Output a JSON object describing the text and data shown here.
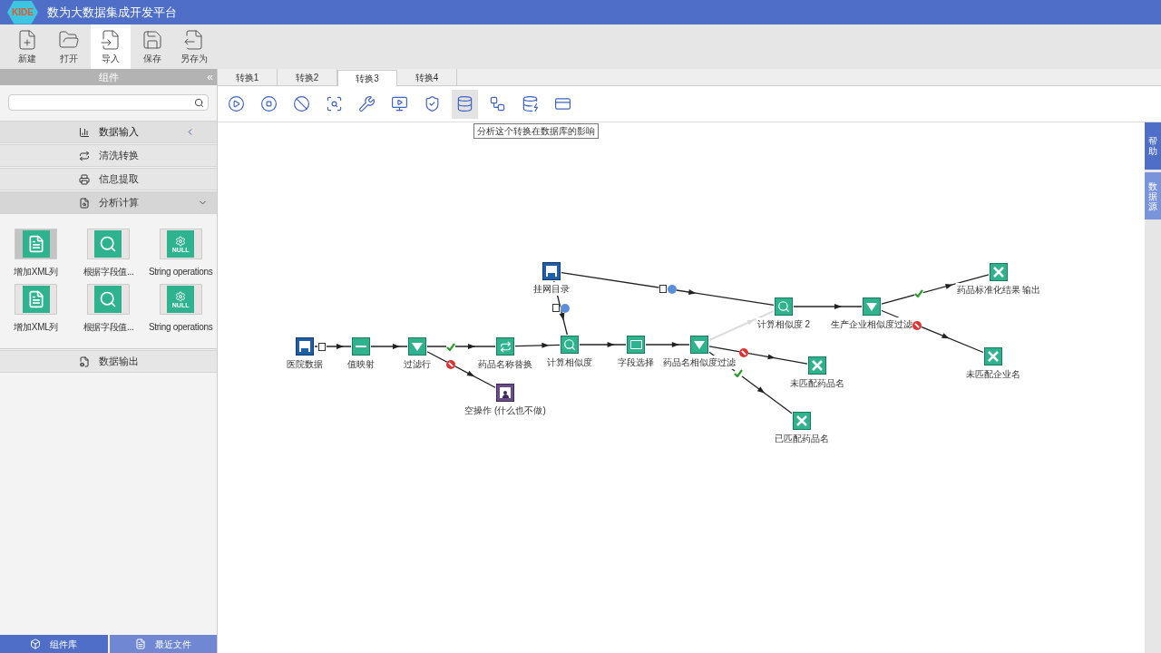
{
  "app": {
    "logo_text": "KIDE",
    "title": "数为大数据集成开发平台"
  },
  "toolbar": [
    {
      "label": "新建",
      "kind": "new",
      "selected": false
    },
    {
      "label": "打开",
      "kind": "open",
      "selected": false
    },
    {
      "label": "导入",
      "kind": "import",
      "selected": true
    },
    {
      "label": "保存",
      "kind": "save",
      "selected": false
    },
    {
      "label": "另存为",
      "kind": "saveas",
      "selected": false
    }
  ],
  "sidebar": {
    "title": "组件",
    "collapse_glyph": "«",
    "categories": [
      {
        "label": "数据输入",
        "kind": "input",
        "expanded": false,
        "hovered": true
      },
      {
        "label": "清洗转换",
        "kind": "clean",
        "expanded": false,
        "hovered": false
      },
      {
        "label": "信息提取",
        "kind": "extract",
        "expanded": false,
        "hovered": false
      },
      {
        "label": "分析计算",
        "kind": "analyze",
        "expanded": true,
        "hovered": false,
        "components": [
          {
            "label": "增加XML列",
            "kind": "xml",
            "selected": true
          },
          {
            "label": "根据字段值...",
            "kind": "lookup",
            "selected": false
          },
          {
            "label": "String operations",
            "kind": "string",
            "badge": "NULL",
            "selected": false
          },
          {
            "label": "增加XML列",
            "kind": "xml",
            "selected": false
          },
          {
            "label": "根据字段值...",
            "kind": "lookup",
            "selected": false
          },
          {
            "label": "String operations",
            "kind": "string",
            "badge": "NULL",
            "selected": false
          }
        ]
      },
      {
        "label": "数据输出",
        "kind": "output",
        "expanded": false,
        "hovered": false
      }
    ]
  },
  "bottom_tabs": [
    {
      "label": "组件库",
      "kind": "library",
      "selected": true
    },
    {
      "label": "最近文件",
      "kind": "recent",
      "selected": false
    }
  ],
  "tabs": [
    {
      "label": "转换1",
      "selected": false
    },
    {
      "label": "转换2",
      "selected": false
    },
    {
      "label": "转换3",
      "selected": true
    },
    {
      "label": "转换4",
      "selected": false
    }
  ],
  "canvas_toolbar": {
    "tools": [
      {
        "kind": "run",
        "hovered": false
      },
      {
        "kind": "stop",
        "hovered": false
      },
      {
        "kind": "cancel",
        "hovered": false
      },
      {
        "kind": "preview",
        "hovered": false
      },
      {
        "kind": "debug",
        "hovered": false
      },
      {
        "kind": "replay",
        "hovered": false
      },
      {
        "kind": "verify",
        "hovered": false
      },
      {
        "kind": "impact",
        "hovered": true
      },
      {
        "kind": "sql",
        "hovered": false
      },
      {
        "kind": "explore",
        "hovered": false
      },
      {
        "kind": "results",
        "hovered": false
      }
    ],
    "tooltip": "分析这个转换在数据库的影响"
  },
  "side_tabs": [
    {
      "label": "帮助",
      "selected": true
    },
    {
      "label": "数据源",
      "selected": false
    }
  ],
  "diagram": {
    "nodes": [
      {
        "label": "医院数据",
        "kind": "input"
      },
      {
        "label": "值映射",
        "kind": "mapping"
      },
      {
        "label": "过滤行",
        "kind": "filter"
      },
      {
        "label": "药品名称替换",
        "kind": "replace"
      },
      {
        "label": "计算相似度",
        "kind": "similarity"
      },
      {
        "label": "空操作 (什么也不做)",
        "kind": "dummy"
      },
      {
        "label": "挂网目录",
        "kind": "input"
      },
      {
        "label": "字段选择",
        "kind": "select"
      },
      {
        "label": "药品名相似度过滤",
        "kind": "filter"
      },
      {
        "label": "计算相似度 2",
        "kind": "similarity"
      },
      {
        "label": "生产企业相似度过滤",
        "kind": "filter"
      },
      {
        "label": "药品标准化结果 输出",
        "kind": "excel"
      },
      {
        "label": "未匹配企业名",
        "kind": "excel"
      },
      {
        "label": "未匹配药品名",
        "kind": "excel"
      },
      {
        "label": "已匹配药品名",
        "kind": "excel"
      }
    ],
    "hops": [
      {
        "kind": "copy",
        "disabled": false
      },
      {
        "kind": "normal",
        "disabled": false
      },
      {
        "kind": "true",
        "disabled": false
      },
      {
        "kind": "false",
        "disabled": false
      },
      {
        "kind": "normal",
        "disabled": false
      },
      {
        "kind": "copy_info",
        "disabled": false
      },
      {
        "kind": "normal",
        "disabled": false
      },
      {
        "kind": "normal",
        "disabled": false
      },
      {
        "kind": "copy_info",
        "disabled": false
      },
      {
        "kind": "normal",
        "disabled": true
      },
      {
        "kind": "normal",
        "disabled": false
      },
      {
        "kind": "true",
        "disabled": false
      },
      {
        "kind": "false",
        "disabled": false
      },
      {
        "kind": "false",
        "disabled": false
      },
      {
        "kind": "true",
        "disabled": false
      }
    ]
  }
}
